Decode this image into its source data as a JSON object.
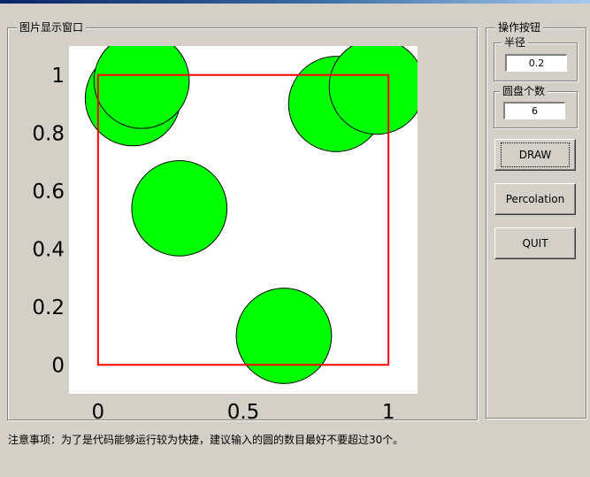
{
  "figure_panel": {
    "title": "图片显示窗口"
  },
  "controls": {
    "title": "操作按钮",
    "radius": {
      "label": "半径",
      "value": "0.2"
    },
    "disk_count": {
      "label": "圆盘个数",
      "value": "6"
    },
    "buttons": {
      "draw": "DRAW",
      "percolation": "Percolation",
      "quit": "QUIT"
    }
  },
  "footer_note": "注意事项：为了是代码能够运行较为快捷，建议输入的圆的数目最好不要超过30个。",
  "colors": {
    "disk_fill": "#00ff00",
    "square_stroke": "#ff0000",
    "axes_bg": "#ffffff"
  },
  "chart_data": {
    "type": "scatter",
    "xlim": [
      -0.1,
      1.1
    ],
    "ylim": [
      -0.1,
      1.1
    ],
    "xticks": [
      0,
      0.5,
      1
    ],
    "xtick_labels": [
      "0",
      "0.5",
      "1"
    ],
    "yticks": [
      0,
      0.2,
      0.4,
      0.6,
      0.8,
      1
    ],
    "ytick_labels": [
      "0",
      "0.2",
      "0.4",
      "0.6",
      "0.8",
      "1"
    ],
    "square": {
      "x0": 0,
      "y0": 0,
      "x1": 1,
      "y1": 1
    },
    "radius": 0.2,
    "disks": [
      {
        "x": 0.12,
        "y": 0.92
      },
      {
        "x": 0.15,
        "y": 0.98
      },
      {
        "x": 0.28,
        "y": 0.54
      },
      {
        "x": 0.82,
        "y": 0.9
      },
      {
        "x": 0.96,
        "y": 0.96
      },
      {
        "x": 0.64,
        "y": 0.1
      }
    ]
  }
}
